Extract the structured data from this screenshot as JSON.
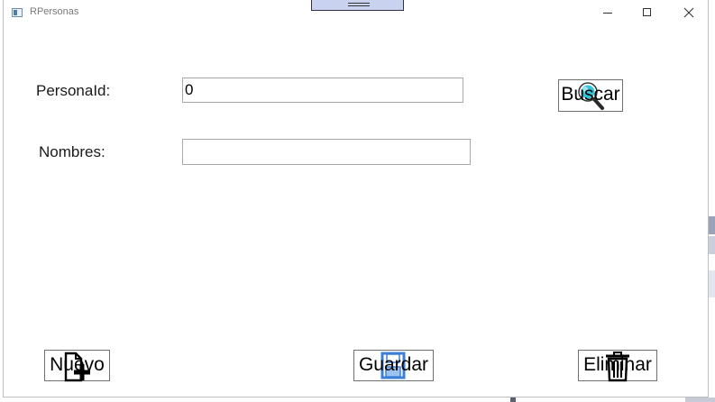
{
  "window": {
    "title": "RPersonas",
    "minimize_icon": "minimize-icon",
    "maximize_icon": "maximize-icon",
    "close_icon": "close-icon"
  },
  "form": {
    "persona_id_label": "PersonaId:",
    "persona_id_value": "0",
    "nombres_label": "Nombres:",
    "nombres_value": ""
  },
  "buttons": {
    "buscar_label": "Buscar",
    "buscar_icon": "magnifier-icon",
    "nuevo_label": "Nuevo",
    "nuevo_icon": "new-document-icon",
    "guardar_label": "Guardar",
    "guardar_icon": "save-disk-icon",
    "eliminar_label": "Eliminar",
    "eliminar_icon": "trash-icon"
  },
  "colors": {
    "accent_blue": "#3d7fd6",
    "magnifier_cyan": "#36c4d8",
    "drag_handle": "#c9d2ef"
  }
}
